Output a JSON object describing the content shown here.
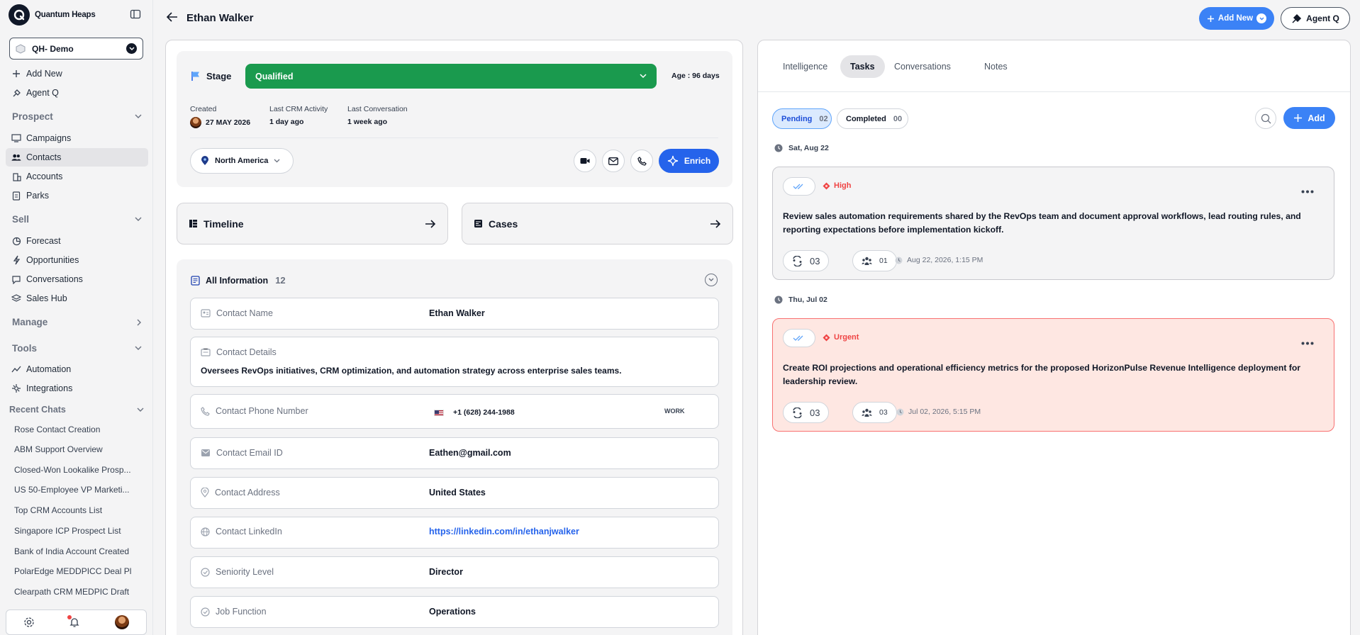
{
  "app": {
    "brand": "Quantum Heaps",
    "workspace": "QH- Demo"
  },
  "sidebar": {
    "top_items": [
      {
        "label": "Add New",
        "icon": "plus-icon"
      },
      {
        "label": "Agent Q",
        "icon": "agent-icon"
      }
    ],
    "sections": {
      "prospect": "Prospect",
      "sell": "Sell",
      "manage": "Manage",
      "tools": "Tools"
    },
    "prospect_items": [
      "Campaigns",
      "Contacts",
      "Accounts",
      "Parks"
    ],
    "sell_items": [
      "Forecast",
      "Opportunities",
      "Conversations",
      "Sales Hub"
    ],
    "tools_items": [
      "Automation",
      "Integrations"
    ],
    "active_item": "Contacts",
    "recent_chats_label": "Recent Chats",
    "recent_chats": [
      "Rose Contact Creation",
      "ABM Support Overview",
      "Closed-Won Lookalike Prosp...",
      "US 50-Employee VP Marketi...",
      "Top CRM Accounts List",
      "Singapore ICP Prospect List",
      "Bank of India Account Created",
      "PolarEdge MEDDPICC Deal Pl...",
      "Clearpath CRM MEDPIC Draft"
    ]
  },
  "header": {
    "title": "Ethan Walker",
    "add_new_label": "Add New",
    "agent_q_label": "Agent Q"
  },
  "stage": {
    "label": "Stage",
    "value": "Qualified",
    "age": "Age : 96 days",
    "color": "#1a9a4e",
    "created_label": "Created",
    "created_value": "27 MAY 2026",
    "last_crm_label": "Last CRM Activity",
    "last_crm_value": "1 day ago",
    "last_conv_label": "Last Conversation",
    "last_conv_value": "1 week ago",
    "region": "North America",
    "enrich_label": "Enrich"
  },
  "cards": {
    "timeline": "Timeline",
    "cases": "Cases"
  },
  "info": {
    "title": "All Information",
    "count": "12",
    "contact_name_label": "Contact Name",
    "contact_name": "Ethan Walker",
    "details_label": "Contact Details",
    "details": "Oversees RevOps initiatives, CRM optimization, and automation strategy across enterprise sales teams.",
    "phone_label": "Contact Phone Number",
    "phone": "+1 (628) 244-1988",
    "phone_type": "WORK",
    "email_label": "Contact Email ID",
    "email": "Eathen@gmail.com",
    "address_label": "Contact Address",
    "address": "United States",
    "linkedin_label": "Contact LinkedIn",
    "linkedin": "https://linkedin.com/in/ethanjwalker",
    "seniority_label": "Seniority Level",
    "seniority": "Director",
    "job_label": "Job Function",
    "job": "Operations"
  },
  "right": {
    "tabs": [
      "Intelligence",
      "Tasks",
      "Conversations",
      "Notes"
    ],
    "active_tab": "Tasks",
    "pending_label": "Pending",
    "pending_count": "02",
    "completed_label": "Completed",
    "completed_count": "00",
    "add_label": "Add",
    "tasks": [
      {
        "date": "Sat, Aug 22",
        "priority": "High",
        "text": "Review sales automation requirements shared by the RevOps team and document approval workflows, lead routing rules, and reporting expectations before implementation kickoff.",
        "subtasks": "03",
        "assignees": "01",
        "due": "Aug 22, 2026, 1:15 PM"
      },
      {
        "date": "Thu, Jul 02",
        "priority": "Urgent",
        "text": "Create ROI projections and operational efficiency metrics for the proposed HorizonPulse Revenue Intelligence deployment for leadership review.",
        "subtasks": "03",
        "assignees": "03",
        "due": "Jul 02, 2026, 5:15 PM"
      }
    ]
  },
  "colors": {
    "accent": "#3b82f6",
    "stage_green": "#1a9a4e",
    "urgent_bg": "#fee7e2",
    "priority_red": "#ef4444"
  }
}
